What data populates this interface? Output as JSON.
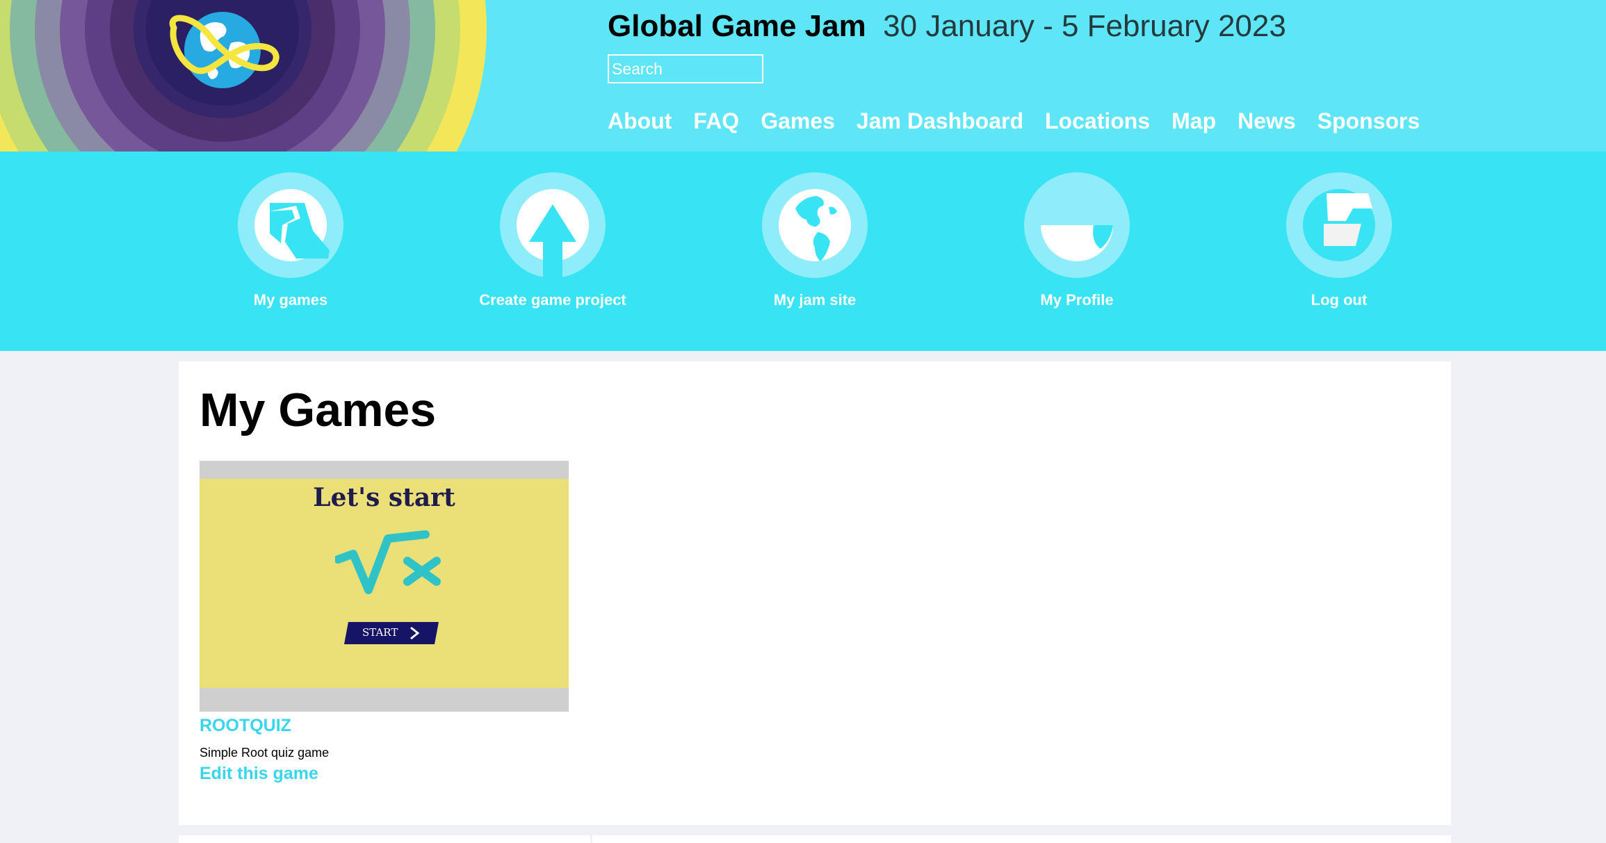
{
  "header": {
    "site_name": "Global Game Jam",
    "dates": "30 January - 5 February 2023",
    "search": {
      "placeholder": "Search",
      "value": ""
    },
    "nav": [
      "About",
      "FAQ",
      "Games",
      "Jam Dashboard",
      "Locations",
      "Map",
      "News",
      "Sponsors"
    ]
  },
  "actions": [
    {
      "label": "My games",
      "icon": "my-games-icon"
    },
    {
      "label": "Create game project",
      "icon": "upload-arrow-icon"
    },
    {
      "label": "My jam site",
      "icon": "globe-icon"
    },
    {
      "label": "My Profile",
      "icon": "profile-icon"
    },
    {
      "label": "Log out",
      "icon": "logout-icon"
    }
  ],
  "main": {
    "title": "My Games",
    "games": [
      {
        "name": "ROOTQUIZ",
        "description": "Simple Root quiz game",
        "edit_label": "Edit this game",
        "thumbnail": {
          "heading": "Let's start",
          "button": "START"
        }
      }
    ]
  },
  "colors": {
    "header_bg": "#5fe6f6",
    "action_bar_bg": "#38e3f4",
    "link": "#38d6ec",
    "page_bg": "#f0f0f7"
  }
}
